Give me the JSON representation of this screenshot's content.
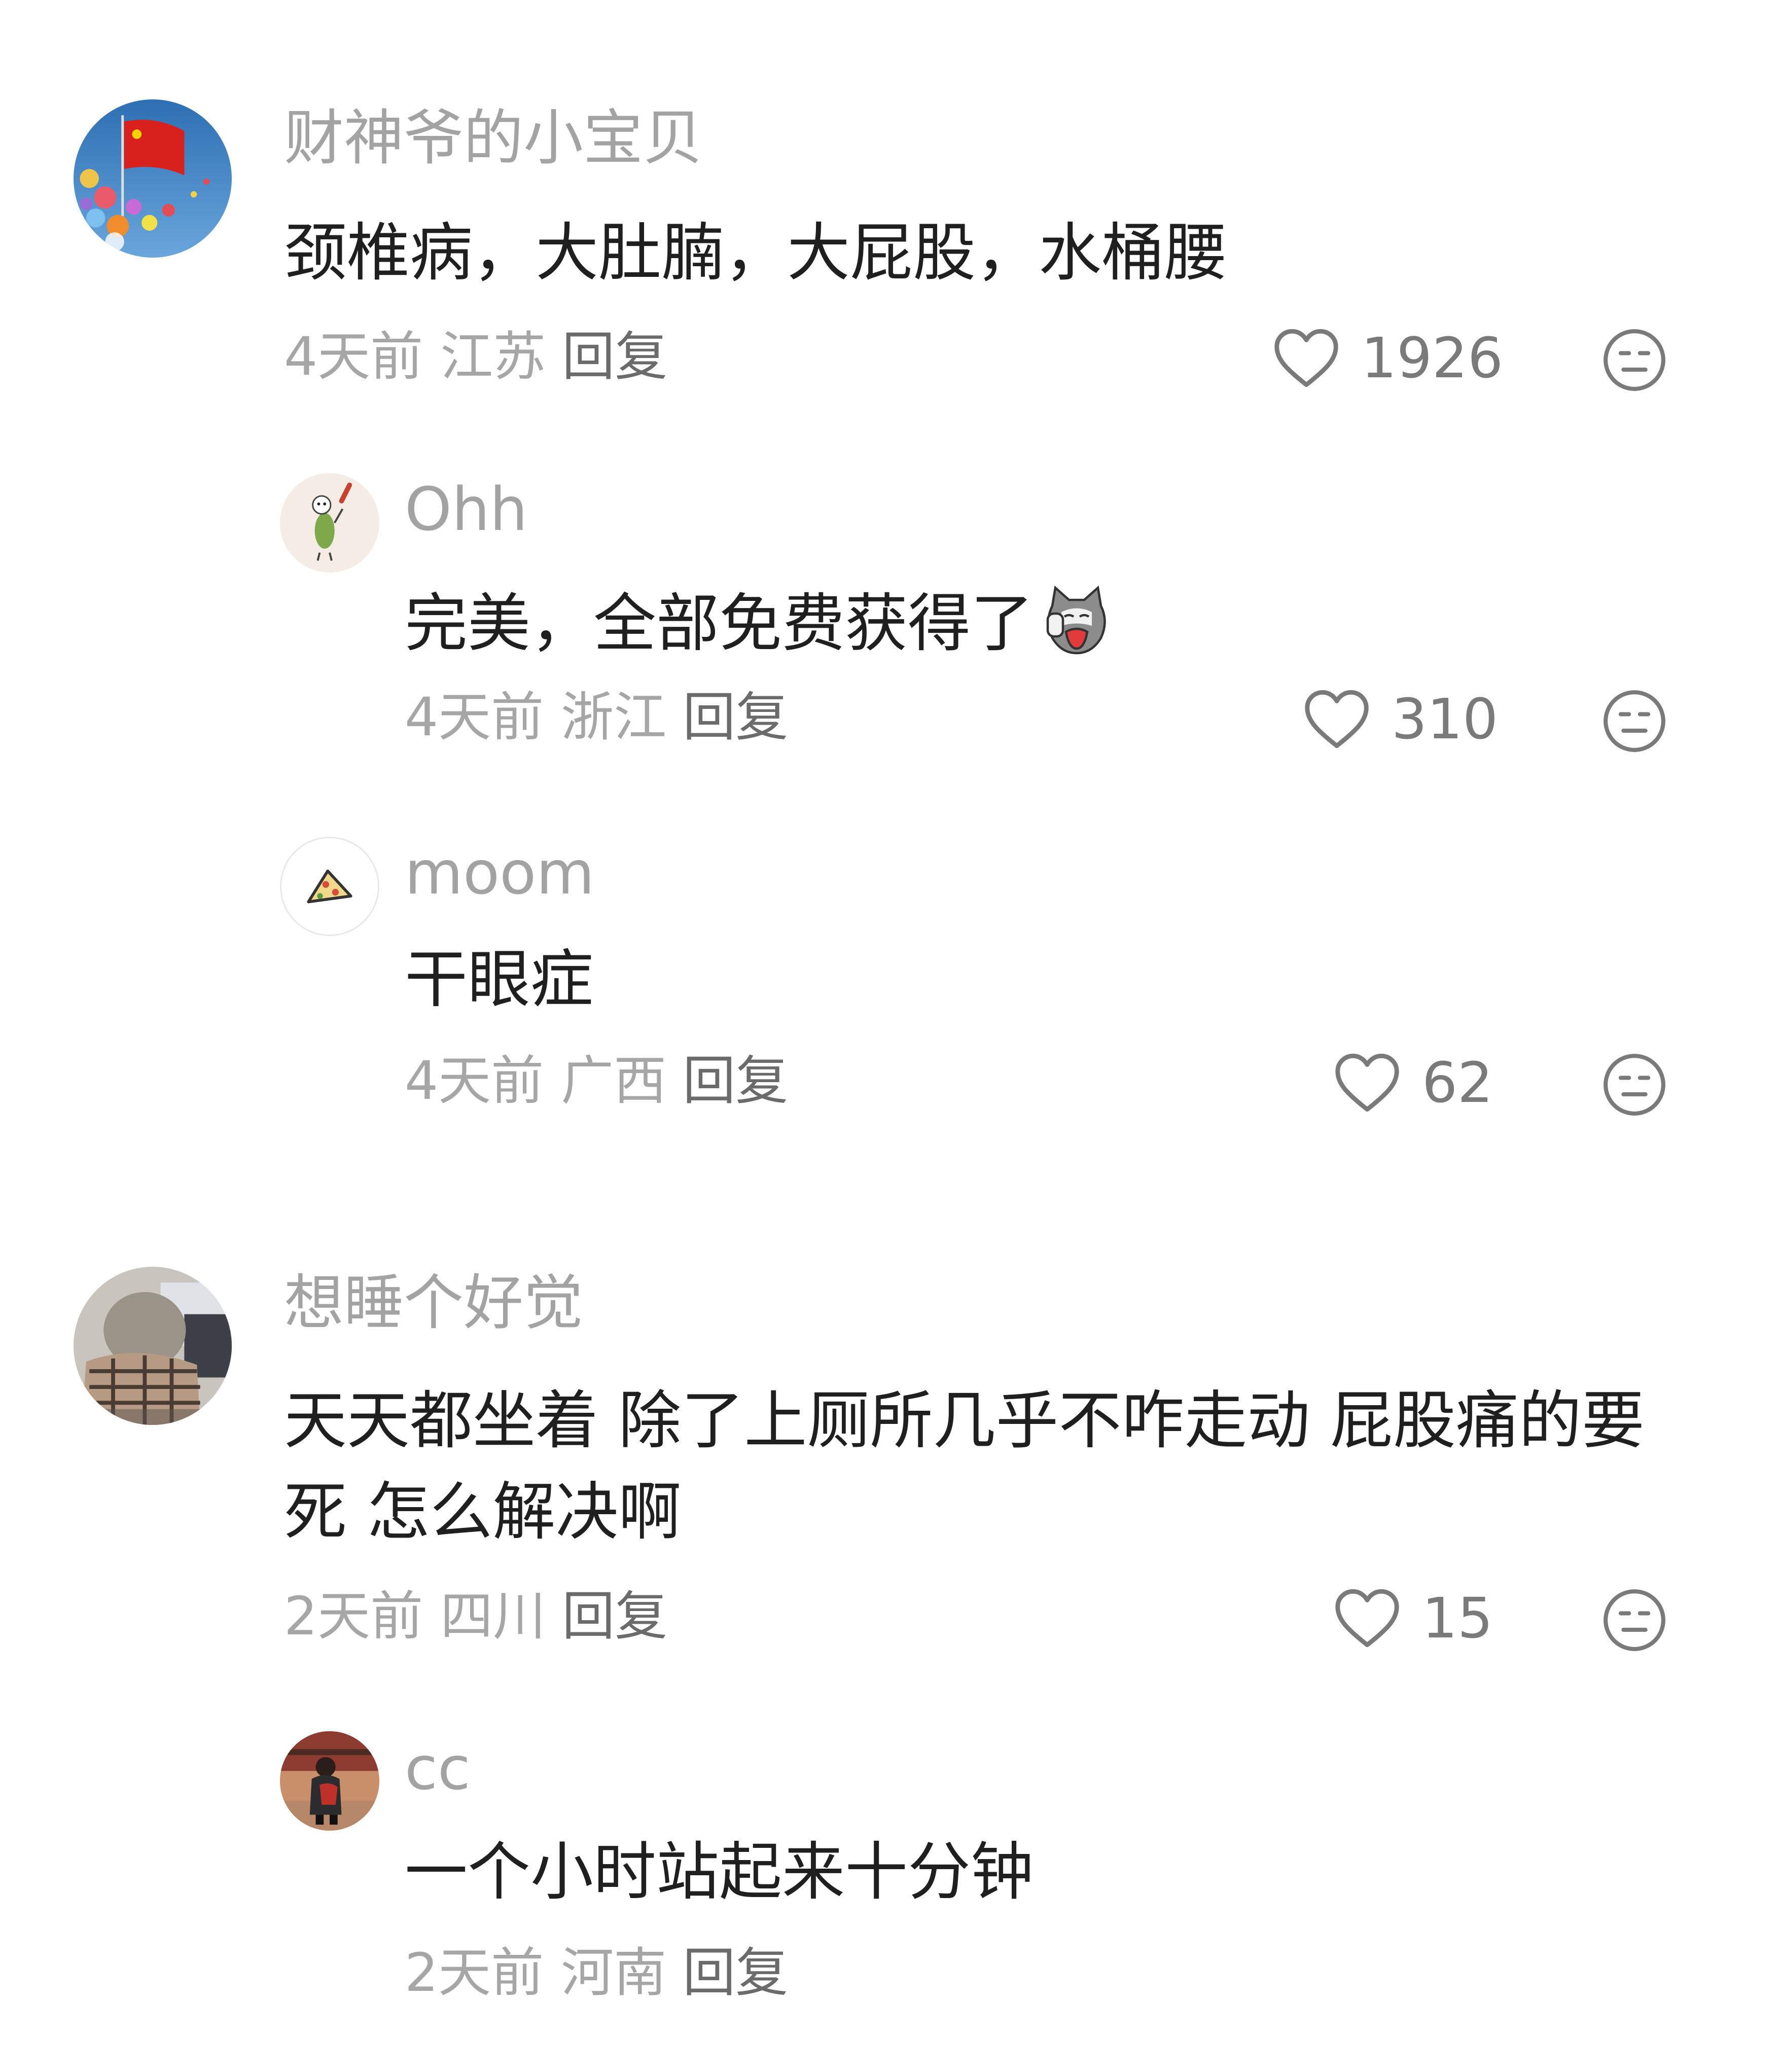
{
  "comments": [
    {
      "username": "财神爷的小宝贝",
      "text": "颈椎病，大肚腩，大屁股，水桶腰",
      "time": "4天前",
      "location": "江苏",
      "reply_label": "回复",
      "likes": "1926",
      "replies": [
        {
          "username": "Ohh",
          "text": "完美，全部免费获得了",
          "time": "4天前",
          "location": "浙江",
          "reply_label": "回复",
          "likes": "310"
        },
        {
          "username": "moom",
          "text": "干眼症",
          "time": "4天前",
          "location": "广西",
          "reply_label": "回复",
          "likes": "62"
        }
      ]
    },
    {
      "username": "想睡个好觉",
      "text": "天天都坐着 除了上厕所几乎不咋走动 屁股痛的要死 怎么解决啊",
      "time": "2天前",
      "location": "四川",
      "reply_label": "回复",
      "likes": "15",
      "replies": [
        {
          "username": "cc",
          "text": "一个小时站起来十分钟",
          "time": "2天前",
          "location": "河南",
          "reply_label": "回复"
        }
      ]
    }
  ],
  "icons": {
    "like": "heart-outline-icon",
    "dislike": "meh-face-icon",
    "inline_emoji": "crying-cat-emoji"
  },
  "colors": {
    "username": "#a3a3a3",
    "text": "#1f1f1f",
    "meta": "#a6a6a6",
    "reply": "#6b6b6b"
  }
}
